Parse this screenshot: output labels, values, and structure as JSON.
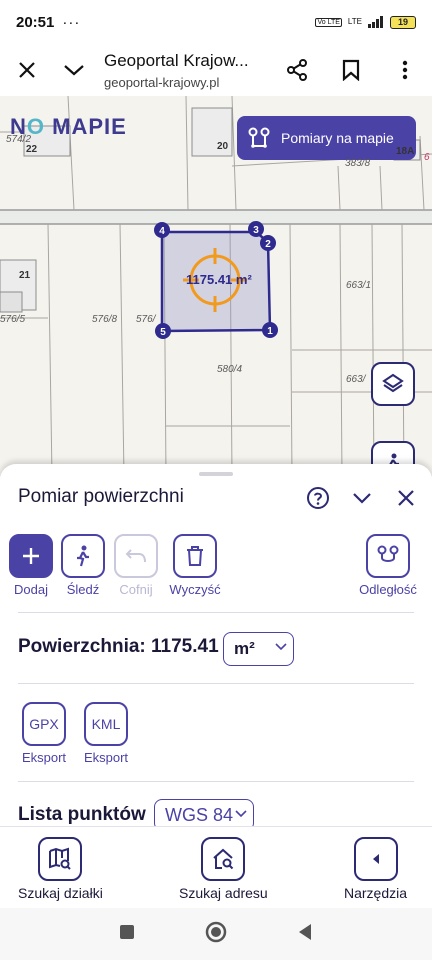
{
  "status": {
    "time": "20:51",
    "dots": "···",
    "vol_label": "Vo LTE",
    "net_label": "LTE",
    "battery": "19"
  },
  "browser": {
    "title": "Geoportal Krajow...",
    "url": "geoportal-krajowy.pl"
  },
  "map": {
    "logo": {
      "part1": "N",
      "part2": "O",
      "part3": " MAPIE"
    },
    "measure_button": "Pomiary na mapie",
    "labels": [
      "574/2",
      "22",
      "20",
      "383/8",
      "18A",
      "6",
      "21",
      "576/5",
      "576/8",
      "576/",
      "663/1",
      "580/4",
      "663/"
    ],
    "polygon_label": "1175.41 m²",
    "vertices": [
      "1",
      "2",
      "3",
      "4",
      "5"
    ]
  },
  "panel": {
    "title": "Pomiar powierzchni",
    "tools": {
      "add": "Dodaj",
      "track": "Śledź",
      "undo": "Cofnij",
      "clear": "Wyczyść",
      "distance": "Odległość"
    },
    "area_label": "Powierzchnia:",
    "area_value": "1175.41",
    "unit": "m²",
    "exports": [
      {
        "code": "GPX",
        "label": "Eksport"
      },
      {
        "code": "KML",
        "label": "Eksport"
      }
    ],
    "points_label": "Lista punktów",
    "crs": "WGS 84"
  },
  "bottom_nav": {
    "parcel": "Szukaj działki",
    "address": "Szukaj adresu",
    "tools": "Narzędzia"
  },
  "colors": {
    "accent": "#4b42a6",
    "dark": "#2c2a72",
    "polygon": "#2e2a8e",
    "crosshair": "#f29a1e"
  }
}
